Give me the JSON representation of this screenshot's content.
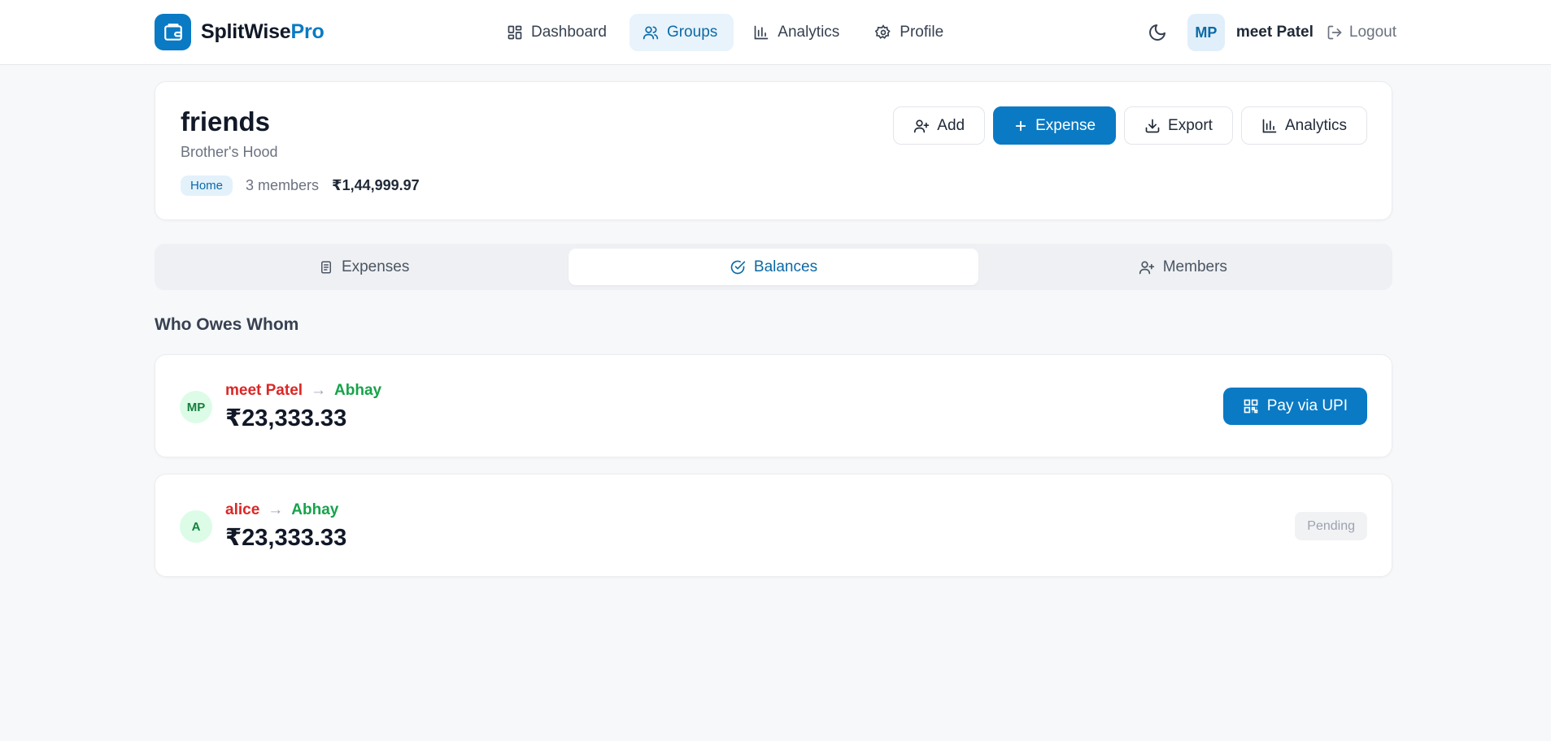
{
  "brand": {
    "name_main": "SplitWise",
    "name_accent": "Pro",
    "accent_color": "#0a7ac4",
    "logo_icon": "wallet-icon"
  },
  "nav": {
    "items": [
      {
        "label": "Dashboard",
        "icon": "grid-icon",
        "active": false
      },
      {
        "label": "Groups",
        "icon": "users-icon",
        "active": true
      },
      {
        "label": "Analytics",
        "icon": "bar-chart-icon",
        "active": false
      },
      {
        "label": "Profile",
        "icon": "gear-icon",
        "active": false
      }
    ]
  },
  "user": {
    "initials": "MP",
    "name": "meet Patel",
    "logout_label": "Logout"
  },
  "group": {
    "name": "friends",
    "description": "Brother's Hood",
    "tag": "Home",
    "members_count": "3 members",
    "total": "₹1,44,999.97",
    "actions": [
      {
        "label": "Add",
        "icon": "user-plus-icon",
        "primary": false
      },
      {
        "label": "Expense",
        "icon": "plus-icon",
        "primary": true
      },
      {
        "label": "Export",
        "icon": "download-icon",
        "primary": false
      },
      {
        "label": "Analytics",
        "icon": "bar-chart-icon",
        "primary": false
      }
    ]
  },
  "tabs": [
    {
      "label": "Expenses",
      "icon": "receipt-icon",
      "active": false
    },
    {
      "label": "Balances",
      "icon": "check-circle-icon",
      "active": true
    },
    {
      "label": "Members",
      "icon": "user-plus-icon",
      "active": false
    }
  ],
  "section_title": "Who Owes Whom",
  "balances": [
    {
      "initials": "MP",
      "from": "meet Patel",
      "arrow": "→",
      "to": "Abhay",
      "amount": "₹23,333.33",
      "action": "Pay via UPI"
    },
    {
      "initials": "A",
      "from": "alice",
      "arrow": "→",
      "to": "Abhay",
      "amount": "₹23,333.33",
      "status": "Pending"
    }
  ],
  "colors": {
    "debtor": "#dc2626",
    "creditor": "#16a34a",
    "primary": "#0a7ac4"
  }
}
